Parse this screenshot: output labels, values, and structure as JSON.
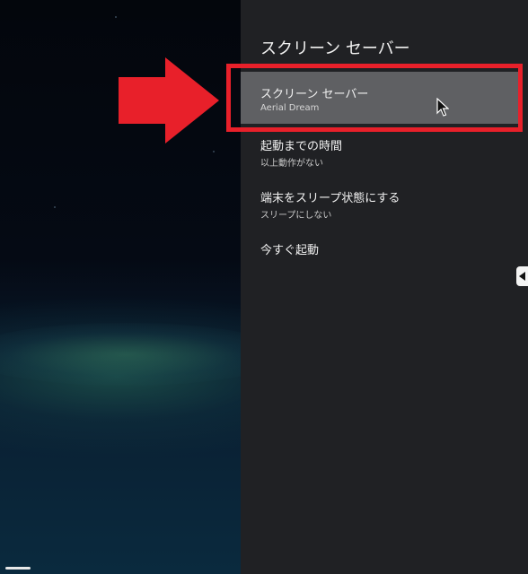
{
  "background": {
    "description_icon": "earth-horizon-screensaver-preview"
  },
  "panel": {
    "title": "スクリーン セーバー",
    "items": [
      {
        "title": "スクリーン セーバー",
        "subtitle": "Aerial Dream",
        "selected": true
      },
      {
        "title": "起動までの時間",
        "subtitle": "以上動作がない",
        "selected": false
      },
      {
        "title": "端末をスリープ状態にする",
        "subtitle": "スリープにしない",
        "selected": false
      },
      {
        "title": "今すぐ起動",
        "subtitle": "",
        "selected": false
      }
    ]
  },
  "annotations": {
    "arrow_color": "#e8202a",
    "box_color": "#e8202a"
  },
  "colors": {
    "panel_bg": "#202124",
    "selected_bg": "#5f6063",
    "text_primary": "#f1f1f1",
    "text_secondary": "#c9c9c9"
  }
}
